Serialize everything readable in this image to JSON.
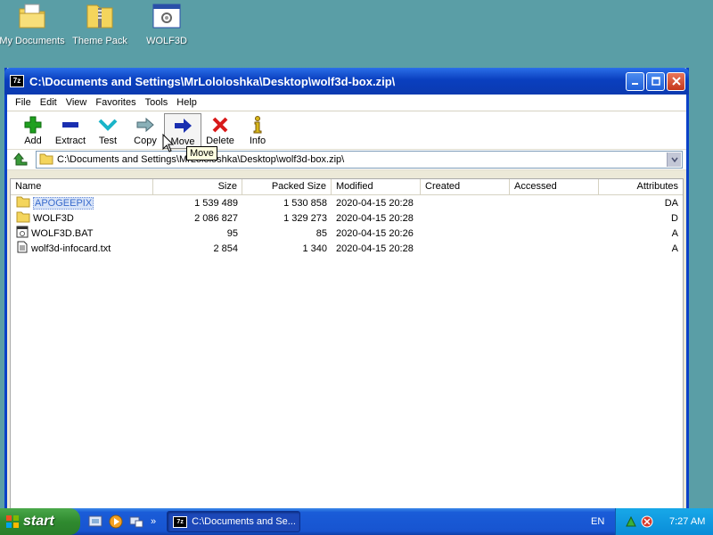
{
  "desktop": {
    "icons": [
      {
        "label": "My Documents",
        "icon": "my-documents-icon"
      },
      {
        "label": "Theme Pack",
        "icon": "zip-folder-icon"
      },
      {
        "label": "WOLF3D",
        "icon": "exe-window-icon"
      }
    ]
  },
  "window": {
    "app_badge": "7z",
    "title": "C:\\Documents and Settings\\MrLololoshka\\Desktop\\wolf3d-box.zip\\",
    "menu": [
      "File",
      "Edit",
      "View",
      "Favorites",
      "Tools",
      "Help"
    ],
    "toolbar": [
      {
        "label": "Add",
        "icon": "add-icon",
        "color": "#1fa01f"
      },
      {
        "label": "Extract",
        "icon": "extract-icon",
        "color": "#1a2fb0"
      },
      {
        "label": "Test",
        "icon": "test-icon",
        "color": "#1ab4c8"
      },
      {
        "label": "Copy",
        "icon": "copy-icon",
        "color": "#5a8a9a"
      },
      {
        "label": "Move",
        "icon": "move-icon",
        "color": "#1a2fb0"
      },
      {
        "label": "Delete",
        "icon": "delete-icon",
        "color": "#d81a1a"
      },
      {
        "label": "Info",
        "icon": "info-icon",
        "color": "#d8b81a"
      }
    ],
    "tooltip": "Move",
    "address": "C:\\Documents and Settings\\MrLololoshka\\Desktop\\wolf3d-box.zip\\",
    "columns": [
      "Name",
      "Size",
      "Packed Size",
      "Modified",
      "Created",
      "Accessed",
      "Attributes"
    ],
    "rows": [
      {
        "name": "APOGEEPIX",
        "type": "folder",
        "size": "1 539 489",
        "packed": "1 530 858",
        "modified": "2020-04-15 20:28",
        "created": "",
        "accessed": "",
        "attributes": "DA",
        "selected": true
      },
      {
        "name": "WOLF3D",
        "type": "folder",
        "size": "2 086 827",
        "packed": "1 329 273",
        "modified": "2020-04-15 20:28",
        "created": "",
        "accessed": "",
        "attributes": "D",
        "selected": false
      },
      {
        "name": "WOLF3D.BAT",
        "type": "bat",
        "size": "95",
        "packed": "85",
        "modified": "2020-04-15 20:26",
        "created": "",
        "accessed": "",
        "attributes": "A",
        "selected": false
      },
      {
        "name": "wolf3d-infocard.txt",
        "type": "txt",
        "size": "2 854",
        "packed": "1 340",
        "modified": "2020-04-15 20:28",
        "created": "",
        "accessed": "",
        "attributes": "A",
        "selected": false
      }
    ]
  },
  "taskbar": {
    "start_label": "start",
    "task_label": "C:\\Documents and Se...",
    "language": "EN",
    "clock": "7:27 AM"
  }
}
